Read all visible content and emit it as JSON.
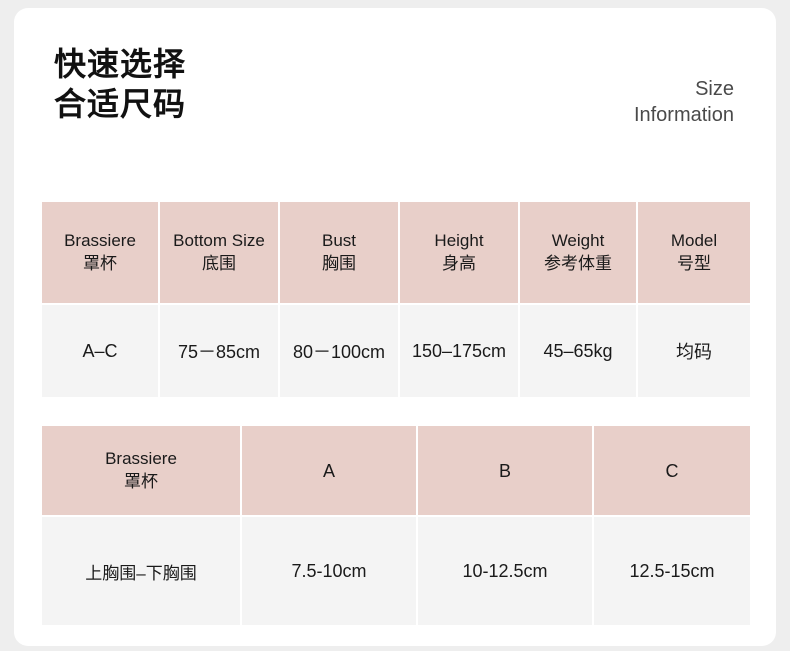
{
  "header": {
    "title_line1": "快速选择",
    "title_line2": "合适尺码",
    "subtitle_line1": "Size",
    "subtitle_line2": "Information"
  },
  "colors": {
    "header_cell": "#e8cfc9",
    "body_cell": "#f4f4f4",
    "page_bg": "#ffffff",
    "canvas_bg": "#eeeeee"
  },
  "table1": {
    "headers": [
      {
        "en": "Brassiere",
        "cn": "罩杯"
      },
      {
        "en": "Bottom Size",
        "cn": "底围"
      },
      {
        "en": "Bust",
        "cn": "胸围"
      },
      {
        "en": "Height",
        "cn": "身高"
      },
      {
        "en": "Weight",
        "cn": "参考体重"
      },
      {
        "en": "Model",
        "cn": "号型"
      }
    ],
    "row": [
      "A–C",
      "75－85cm",
      "80－100cm",
      "150–175cm",
      "45–65kg",
      "均码"
    ]
  },
  "table2": {
    "headers": [
      {
        "en": "Brassiere",
        "cn": "罩杯"
      },
      {
        "en": "",
        "cn": "A"
      },
      {
        "en": "",
        "cn": "B"
      },
      {
        "en": "",
        "cn": "C"
      }
    ],
    "row": [
      "上胸围–下胸围",
      "7.5-10cm",
      "10-12.5cm",
      "12.5-15cm"
    ]
  }
}
